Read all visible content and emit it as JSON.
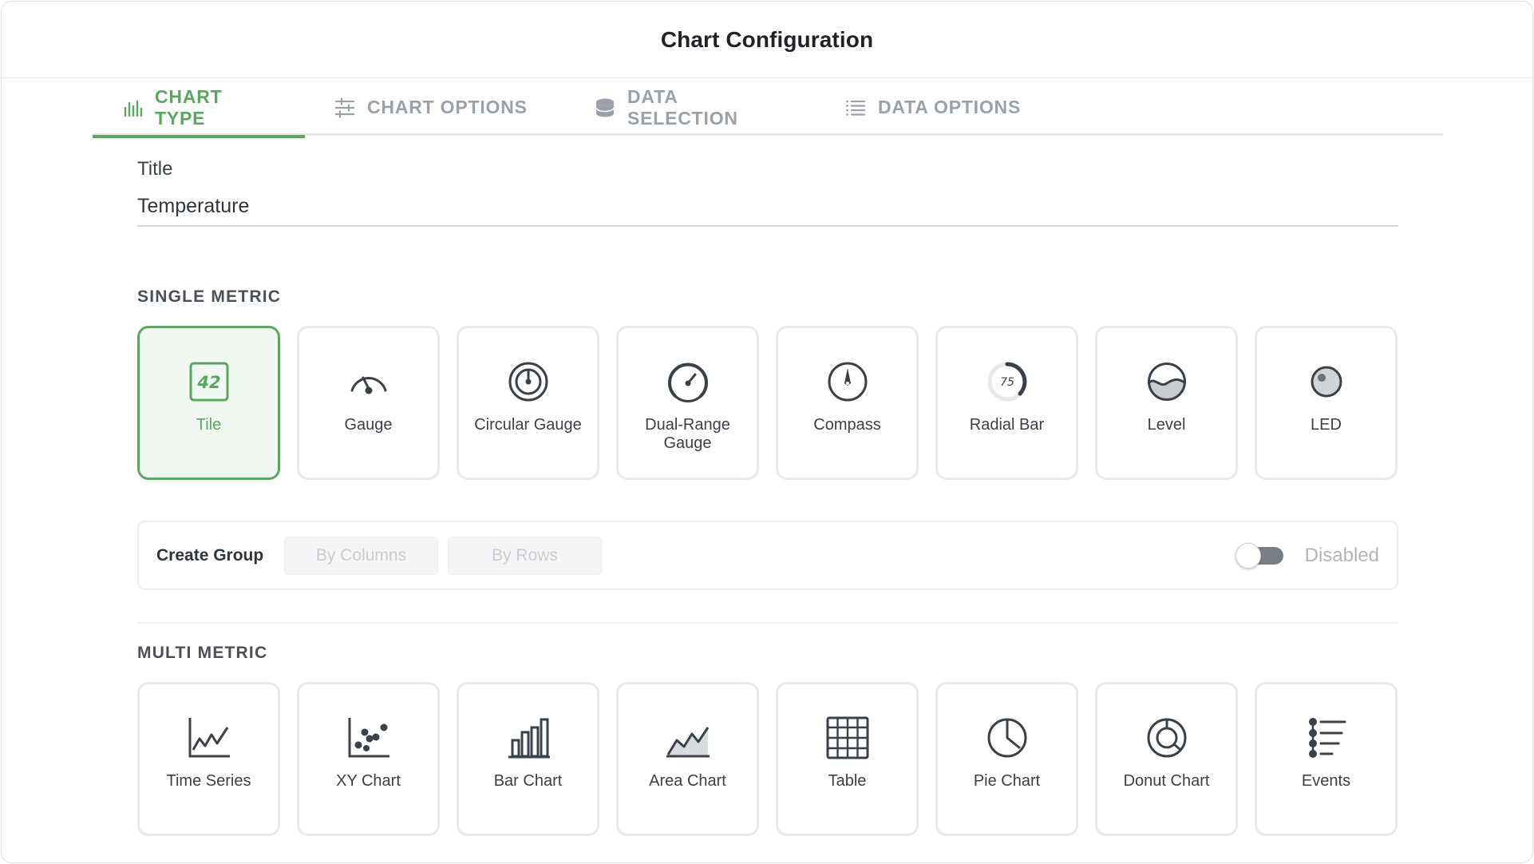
{
  "header": {
    "title": "Chart Configuration"
  },
  "tabs": [
    {
      "label": "CHART TYPE",
      "icon": "bar-chart-icon",
      "active": true
    },
    {
      "label": "CHART OPTIONS",
      "icon": "sliders-icon",
      "active": false
    },
    {
      "label": "DATA SELECTION",
      "icon": "database-icon",
      "active": false
    },
    {
      "label": "DATA OPTIONS",
      "icon": "list-icon",
      "active": false
    }
  ],
  "title_field": {
    "label": "Title",
    "value": "Temperature"
  },
  "single_metric": {
    "heading": "SINGLE METRIC",
    "items": [
      {
        "label": "Tile",
        "icon": "tile-icon",
        "icon_text": "42",
        "selected": true
      },
      {
        "label": "Gauge",
        "icon": "gauge-icon"
      },
      {
        "label": "Circular Gauge",
        "icon": "circular-gauge-icon"
      },
      {
        "label": "Dual-Range Gauge",
        "icon": "dual-range-gauge-icon"
      },
      {
        "label": "Compass",
        "icon": "compass-icon"
      },
      {
        "label": "Radial Bar",
        "icon": "radial-bar-icon",
        "icon_text": "75"
      },
      {
        "label": "Level",
        "icon": "level-icon"
      },
      {
        "label": "LED",
        "icon": "led-icon"
      }
    ]
  },
  "group": {
    "label": "Create Group",
    "by_columns": "By Columns",
    "by_rows": "By Rows",
    "toggle_label": "Disabled",
    "enabled": false
  },
  "multi_metric": {
    "heading": "MULTI METRIC",
    "items": [
      {
        "label": "Time Series",
        "icon": "time-series-icon"
      },
      {
        "label": "XY Chart",
        "icon": "xy-chart-icon"
      },
      {
        "label": "Bar Chart",
        "icon": "bar-chart-icon"
      },
      {
        "label": "Area Chart",
        "icon": "area-chart-icon"
      },
      {
        "label": "Table",
        "icon": "table-icon"
      },
      {
        "label": "Pie Chart",
        "icon": "pie-chart-icon"
      },
      {
        "label": "Donut Chart",
        "icon": "donut-chart-icon"
      },
      {
        "label": "Events",
        "icon": "events-icon"
      }
    ]
  },
  "colors": {
    "accent": "#5aa85f",
    "icon": "#3b4148",
    "muted": "#9aa1a8"
  }
}
